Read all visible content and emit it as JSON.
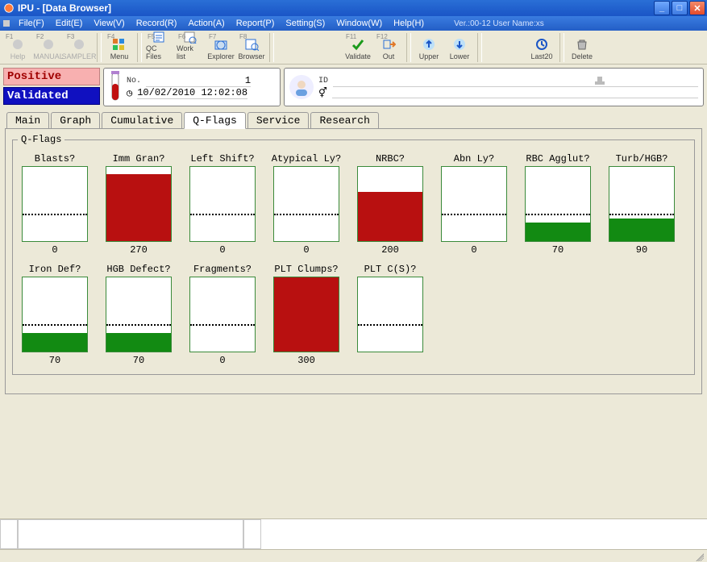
{
  "window": {
    "title": "IPU - [Data Browser]",
    "version_user": "Ver.:00-12 User Name:xs"
  },
  "menu": {
    "file": "File(F)",
    "edit": "Edit(E)",
    "view": "View(V)",
    "record": "Record(R)",
    "action": "Action(A)",
    "report": "Report(P)",
    "setting": "Setting(S)",
    "window": "Window(W)",
    "help": "Help(H)"
  },
  "toolbar": {
    "help": "Help",
    "help_fk": "F1",
    "manual": "MANUAL",
    "manual_fk": "F2",
    "sampler": "SAMPLER",
    "sampler_fk": "F3",
    "menu": "Menu",
    "menu_fk": "F4",
    "qcfiles": "QC Files",
    "qcfiles_fk": "F5",
    "worklist": "Work list",
    "worklist_fk": "F6",
    "explorer": "Explorer",
    "explorer_fk": "F7",
    "browser": "Browser",
    "browser_fk": "F8",
    "validate": "Validate",
    "validate_fk": "F11",
    "out": "Out",
    "out_fk": "F12",
    "upper": "Upper",
    "lower": "Lower",
    "last20": "Last20",
    "delete": "Delete"
  },
  "status": {
    "positive": "Positive",
    "validated": "Validated"
  },
  "sample": {
    "no_label": "No.",
    "no_value": "1",
    "datetime": "10/02/2010   12:02:08"
  },
  "patient": {
    "id_label": "ID"
  },
  "tabs": {
    "main": "Main",
    "graph": "Graph",
    "cumulative": "Cumulative",
    "qflags": "Q-Flags",
    "service": "Service",
    "research": "Research"
  },
  "qflags_legend": "Q-Flags",
  "flags": [
    {
      "title": "Blasts?",
      "value": "0",
      "fill_pct": 0,
      "color": "none",
      "thresh_pct": 35
    },
    {
      "title": "Imm Gran?",
      "value": "270",
      "fill_pct": 90,
      "color": "red",
      "thresh_pct": 35
    },
    {
      "title": "Left Shift?",
      "value": "0",
      "fill_pct": 0,
      "color": "none",
      "thresh_pct": 35
    },
    {
      "title": "Atypical Ly?",
      "value": "0",
      "fill_pct": 0,
      "color": "none",
      "thresh_pct": 35
    },
    {
      "title": "NRBC?",
      "value": "200",
      "fill_pct": 66,
      "color": "red",
      "thresh_pct": 35
    },
    {
      "title": "Abn Ly?",
      "value": "0",
      "fill_pct": 0,
      "color": "none",
      "thresh_pct": 35
    },
    {
      "title": "RBC Agglut?",
      "value": "70",
      "fill_pct": 25,
      "color": "green",
      "thresh_pct": 35
    },
    {
      "title": "Turb/HGB?",
      "value": "90",
      "fill_pct": 30,
      "color": "green",
      "thresh_pct": 35
    },
    {
      "title": "Iron Def?",
      "value": "70",
      "fill_pct": 25,
      "color": "green",
      "thresh_pct": 35
    },
    {
      "title": "HGB Defect?",
      "value": "70",
      "fill_pct": 25,
      "color": "green",
      "thresh_pct": 35
    },
    {
      "title": "Fragments?",
      "value": "0",
      "fill_pct": 0,
      "color": "none",
      "thresh_pct": 35
    },
    {
      "title": "PLT Clumps?",
      "value": "300",
      "fill_pct": 100,
      "color": "red",
      "thresh_pct": 35
    },
    {
      "title": "PLT C(S)?",
      "value": "",
      "fill_pct": 0,
      "color": "none",
      "thresh_pct": 35
    }
  ],
  "chart_data": {
    "type": "bar",
    "title": "Q-Flags",
    "categories": [
      "Blasts?",
      "Imm Gran?",
      "Left Shift?",
      "Atypical Ly?",
      "NRBC?",
      "Abn Ly?",
      "RBC Agglut?",
      "Turb/HGB?",
      "Iron Def?",
      "HGB Defect?",
      "Fragments?",
      "PLT Clumps?",
      "PLT C(S)?"
    ],
    "values": [
      0,
      270,
      0,
      0,
      200,
      0,
      70,
      90,
      70,
      70,
      0,
      300,
      null
    ],
    "threshold": 100,
    "ylim": [
      0,
      300
    ],
    "series_colors": [
      "none",
      "red",
      "none",
      "none",
      "red",
      "none",
      "green",
      "green",
      "green",
      "green",
      "none",
      "red",
      "none"
    ],
    "xlabel": "",
    "ylabel": ""
  }
}
